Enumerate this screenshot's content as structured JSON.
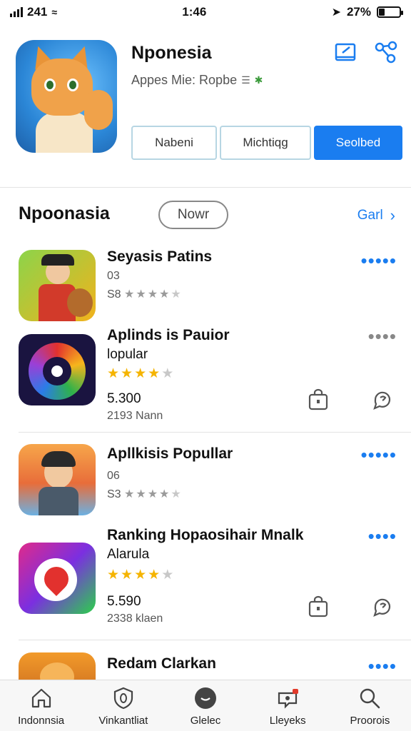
{
  "status_bar": {
    "carrier": "241",
    "time": "1:46",
    "battery": "27%",
    "battery_level": 0.27
  },
  "app_header": {
    "title": "Nponesia",
    "subtitle": "Appes Mie: Ropbe",
    "buttons": [
      "Nabeni",
      "Michtiqg",
      "Seolbed"
    ]
  },
  "section": {
    "title": "Npoonasia",
    "chip": "Nowr",
    "see_all": "Garl"
  },
  "apps": [
    {
      "title": "Seyasis Patins",
      "line1": "03",
      "line2": "S8",
      "stars": 4,
      "rating_value": 4
    },
    {
      "title": "Aplinds is Pauior",
      "line1": "lopular",
      "price": "5.300",
      "line2": "2193 Nann",
      "stars": 4,
      "rating_value": 4
    },
    {
      "title": "Apllkisis Popullar",
      "line1": "06",
      "line2": "S3",
      "stars": 4,
      "rating_value": 4
    },
    {
      "title": "Ranking Hopaosihair Mnalk",
      "line1": "Alarula",
      "price": "5.590",
      "line2": "2338 klaen",
      "stars": 3.5,
      "rating_value": 3.5
    },
    {
      "title": "Redam Clarkan"
    }
  ],
  "tabs": [
    {
      "label": "Indonnsia",
      "icon": "home-icon"
    },
    {
      "label": "Vinkantliat",
      "icon": "shield-icon"
    },
    {
      "label": "Glelec",
      "icon": "games-icon"
    },
    {
      "label": "Lleyeks",
      "icon": "updates-icon"
    },
    {
      "label": "Proorois",
      "icon": "search-icon"
    }
  ]
}
